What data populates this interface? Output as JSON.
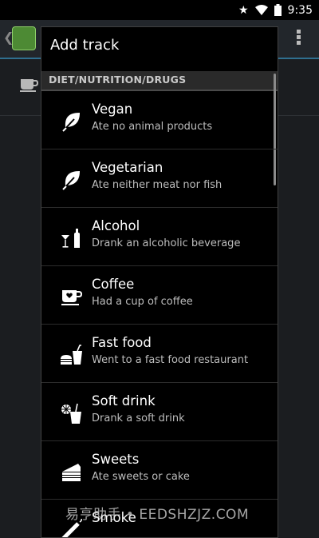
{
  "status_bar": {
    "time": "9:35"
  },
  "dialog": {
    "title": "Add track",
    "section_header": "DIET/NUTRITION/DRUGS",
    "items": [
      {
        "name": "Vegan",
        "description": "Ate no animal products",
        "icon": "leaf-icon"
      },
      {
        "name": "Vegetarian",
        "description": "Ate neither meat nor fish",
        "icon": "leaf-icon"
      },
      {
        "name": "Alcohol",
        "description": "Drank an alcoholic beverage",
        "icon": "alcohol-icon"
      },
      {
        "name": "Coffee",
        "description": "Had a cup of coffee",
        "icon": "coffee-cup-icon"
      },
      {
        "name": "Fast food",
        "description": "Went to a fast food restaurant",
        "icon": "fast-food-icon"
      },
      {
        "name": "Soft drink",
        "description": "Drank a soft drink",
        "icon": "soft-drink-icon"
      },
      {
        "name": "Sweets",
        "description": "Ate sweets or cake",
        "icon": "cake-icon"
      },
      {
        "name": "Smoke",
        "description": "",
        "icon": "cigarette-icon"
      }
    ]
  },
  "watermark": "易亨助手 • EEDSHZJZ.COM"
}
